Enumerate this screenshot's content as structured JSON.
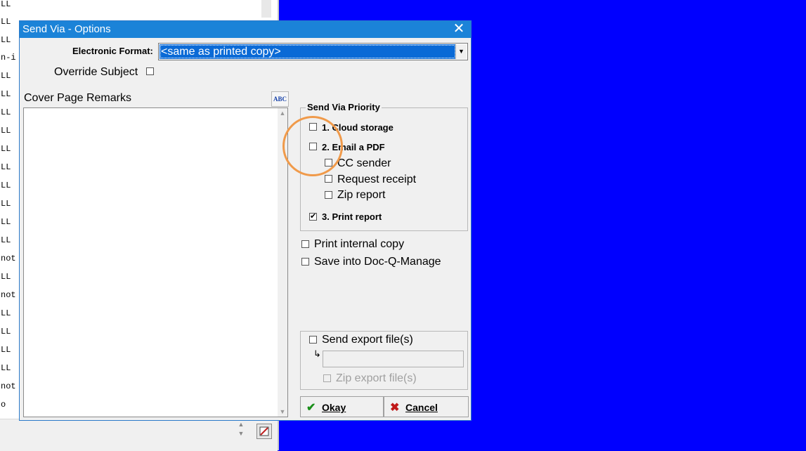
{
  "background_app": {
    "lines": [
      "LL",
      "LL",
      "LL",
      "n-i",
      "LL",
      "LL",
      "LL",
      "LL",
      "LL",
      "LL",
      "LL",
      "LL",
      "LL",
      "LL",
      "not",
      "LL",
      "not",
      "LL",
      "LL",
      "LL",
      "LL",
      "not",
      "o"
    ]
  },
  "dialog": {
    "title": "Send Via - Options",
    "electronic_format_label": "Electronic Format:",
    "electronic_format_value": "<same as printed copy>",
    "override_subject_label": "Override Subject",
    "override_subject_checked": false,
    "cover_page_remarks_label": "Cover Page Remarks",
    "cover_page_remarks_value": "",
    "send_via_priority": {
      "title": "Send Via Priority",
      "cloud_storage": {
        "label": "1. Cloud storage",
        "checked": false
      },
      "email_pdf": {
        "label": "2. Email a PDF",
        "checked": false
      },
      "cc_sender": {
        "label": "CC sender",
        "checked": false
      },
      "request_receipt": {
        "label": "Request receipt",
        "checked": false
      },
      "zip_report": {
        "label": "Zip report",
        "checked": false
      },
      "print_report": {
        "label": "3. Print report",
        "checked": true
      }
    },
    "print_internal_copy": {
      "label": "Print internal copy",
      "checked": false
    },
    "save_into_doc": {
      "label": "Save into Doc-Q-Manage",
      "checked": false
    },
    "export": {
      "send_export_label": "Send export file(s)",
      "send_export_checked": false,
      "path_value": "",
      "zip_export_label": "Zip export file(s)",
      "zip_export_checked": false
    },
    "buttons": {
      "okay": "Okay",
      "cancel": "Cancel"
    },
    "close_glyph": "✕",
    "okay_glyph": "✔",
    "cancel_glyph": "✖",
    "spell_glyph": "ABC"
  },
  "colors": {
    "desktop": "#0000ff",
    "titlebar": "#1b83d8",
    "selection": "#0a6ad6",
    "highlight_ring": "#f09a4a"
  }
}
